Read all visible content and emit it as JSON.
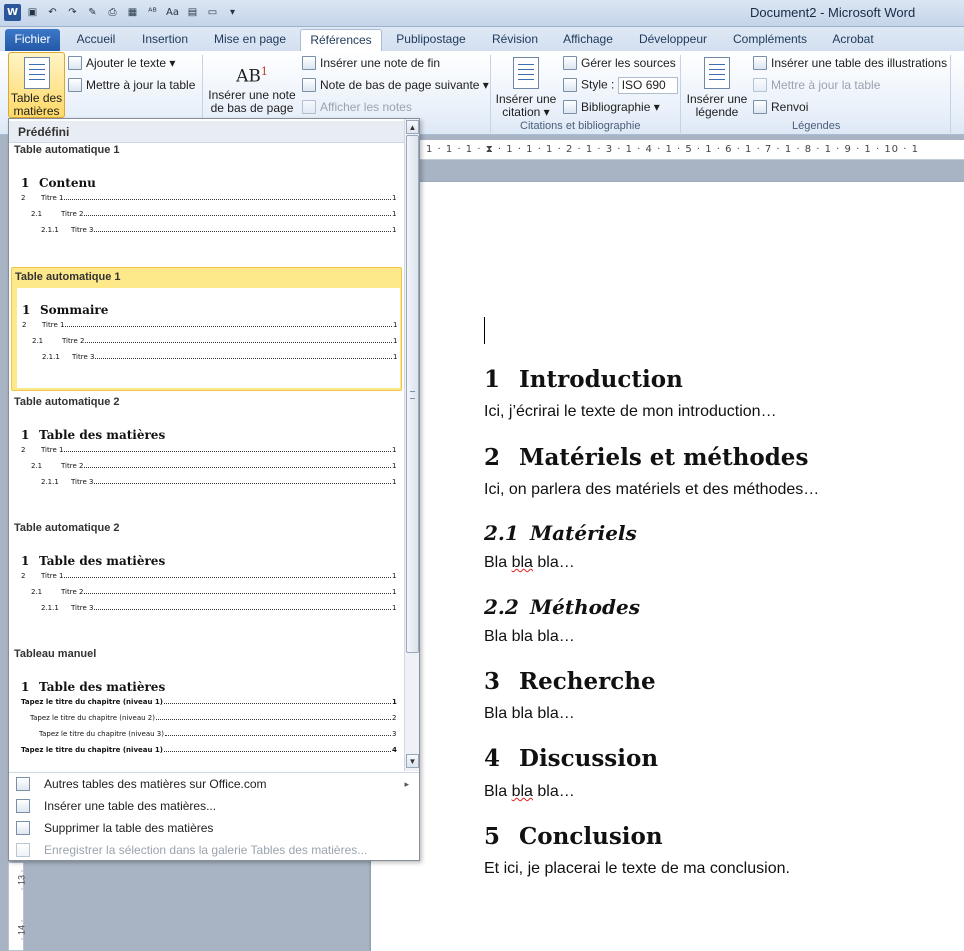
{
  "window": {
    "title": "Document2  -  Microsoft Word"
  },
  "tabs": [
    {
      "label": "Fichier"
    },
    {
      "label": "Accueil"
    },
    {
      "label": "Insertion"
    },
    {
      "label": "Mise en page"
    },
    {
      "label": "Références"
    },
    {
      "label": "Publipostage"
    },
    {
      "label": "Révision"
    },
    {
      "label": "Affichage"
    },
    {
      "label": "Développeur"
    },
    {
      "label": "Compléments"
    },
    {
      "label": "Acrobat"
    }
  ],
  "ribbon": {
    "toc": {
      "label_line1": "Table des",
      "label_line2": "matières ▾"
    },
    "add_text": "Ajouter le texte ▾",
    "update_table": "Mettre à jour la table",
    "insert_footnote": {
      "line1": "Insérer une note",
      "line2": "de bas de page"
    },
    "insert_endnote": "Insérer une note de fin",
    "next_footnote": "Note de bas de page suivante ▾",
    "show_notes": "Afficher les notes",
    "insert_citation": {
      "line1": "Insérer une",
      "line2": "citation ▾"
    },
    "manage_sources": "Gérer les sources",
    "style_label": "Style :",
    "style_value": "ISO 690",
    "bibliography": "Bibliographie ▾",
    "citations_group": "Citations et bibliographie",
    "insert_caption": {
      "line1": "Insérer une",
      "line2": "légende"
    },
    "insert_table_figures": "Insérer une table des illustrations",
    "update_table_captions": "Mettre à jour la table",
    "cross_reference": "Renvoi",
    "captions_group": "Légendes"
  },
  "ruler": {
    "numbers": "1 · 1 · 1 · ⧗ · 1 · 1 · 1 · 2 · 1 · 3 · 1 · 4 · 1 · 5 · 1 · 6 · 1 · 7 · 1 · 8 · 1 · 9 · 1 · 10 · 1"
  },
  "vruler": {
    "n13": "· 13 ·",
    "n14": "· 14 ·"
  },
  "gallery": {
    "section": "Prédéfini",
    "items": [
      {
        "title": "Table automatique 1",
        "heading_num": "1",
        "heading": "Contenu",
        "lines": [
          {
            "num": "2",
            "text": "Titre 1",
            "page": "1"
          },
          {
            "num": "2.1",
            "text": "Titre 2",
            "page": "1"
          },
          {
            "num": "2.1.1",
            "text": "Titre 3",
            "page": "1"
          }
        ]
      },
      {
        "title": "Table automatique 1",
        "heading_num": "1",
        "heading": "Sommaire",
        "lines": [
          {
            "num": "2",
            "text": "Titre 1",
            "page": "1"
          },
          {
            "num": "2.1",
            "text": "Titre 2",
            "page": "1"
          },
          {
            "num": "2.1.1",
            "text": "Titre 3",
            "page": "1"
          }
        ]
      },
      {
        "title": "Table automatique 2",
        "heading_num": "1",
        "heading": "Table des matières",
        "lines": [
          {
            "num": "2",
            "text": "Titre 1",
            "page": "1"
          },
          {
            "num": "2.1",
            "text": "Titre 2",
            "page": "1"
          },
          {
            "num": "2.1.1",
            "text": "Titre 3",
            "page": "1"
          }
        ]
      },
      {
        "title": "Table automatique 2",
        "heading_num": "1",
        "heading": "Table des matières",
        "lines": [
          {
            "num": "2",
            "text": "Titre 1",
            "page": "1"
          },
          {
            "num": "2.1",
            "text": "Titre 2",
            "page": "1"
          },
          {
            "num": "2.1.1",
            "text": "Titre 3",
            "page": "1"
          }
        ]
      },
      {
        "title": "Tableau manuel",
        "heading_num": "1",
        "heading": "Table des matières",
        "lines": [
          {
            "text": "Tapez le titre du chapitre (niveau 1)",
            "page": "1"
          },
          {
            "text": "Tapez le titre du chapitre (niveau 2)",
            "page": "2"
          },
          {
            "text": "Tapez le titre du chapitre (niveau 3)",
            "page": "3"
          },
          {
            "text": "Tapez le titre du chapitre (niveau 1)",
            "page": "4"
          }
        ]
      }
    ]
  },
  "menu": [
    {
      "label": "Autres tables des matières sur Office.com",
      "has_arrow": true,
      "arrow": "▸"
    },
    {
      "label": "Insérer une table des matières..."
    },
    {
      "label": "Supprimer la table des matières"
    },
    {
      "label": "Enregistrer la sélection dans la galerie Tables des matières..."
    }
  ],
  "document": {
    "h1": {
      "num": "1",
      "text": "Introduction"
    },
    "p1": "Ici, j’écrirai le texte de mon introduction…",
    "h2": {
      "num": "2",
      "text": "Matériels et méthodes"
    },
    "p2": "Ici, on parlera des matériels  et des méthodes…",
    "h21": {
      "num": "2.1",
      "text": "Matériels"
    },
    "p21": {
      "a": "Bla ",
      "b": "bla",
      "c": " bla…"
    },
    "h22": {
      "num": "2.2",
      "text": "Méthodes"
    },
    "p22": "Bla bla bla…",
    "h3": {
      "num": "3",
      "text": "Recherche"
    },
    "p3": "Bla bla bla…",
    "h4": {
      "num": "4",
      "text": "Discussion"
    },
    "p4": {
      "a": "Bla ",
      "b": "bla",
      "c": " bla…"
    },
    "h5": {
      "num": "5",
      "text": "Conclusion"
    },
    "p5": "Et ici, je placerai le texte de ma conclusion."
  }
}
